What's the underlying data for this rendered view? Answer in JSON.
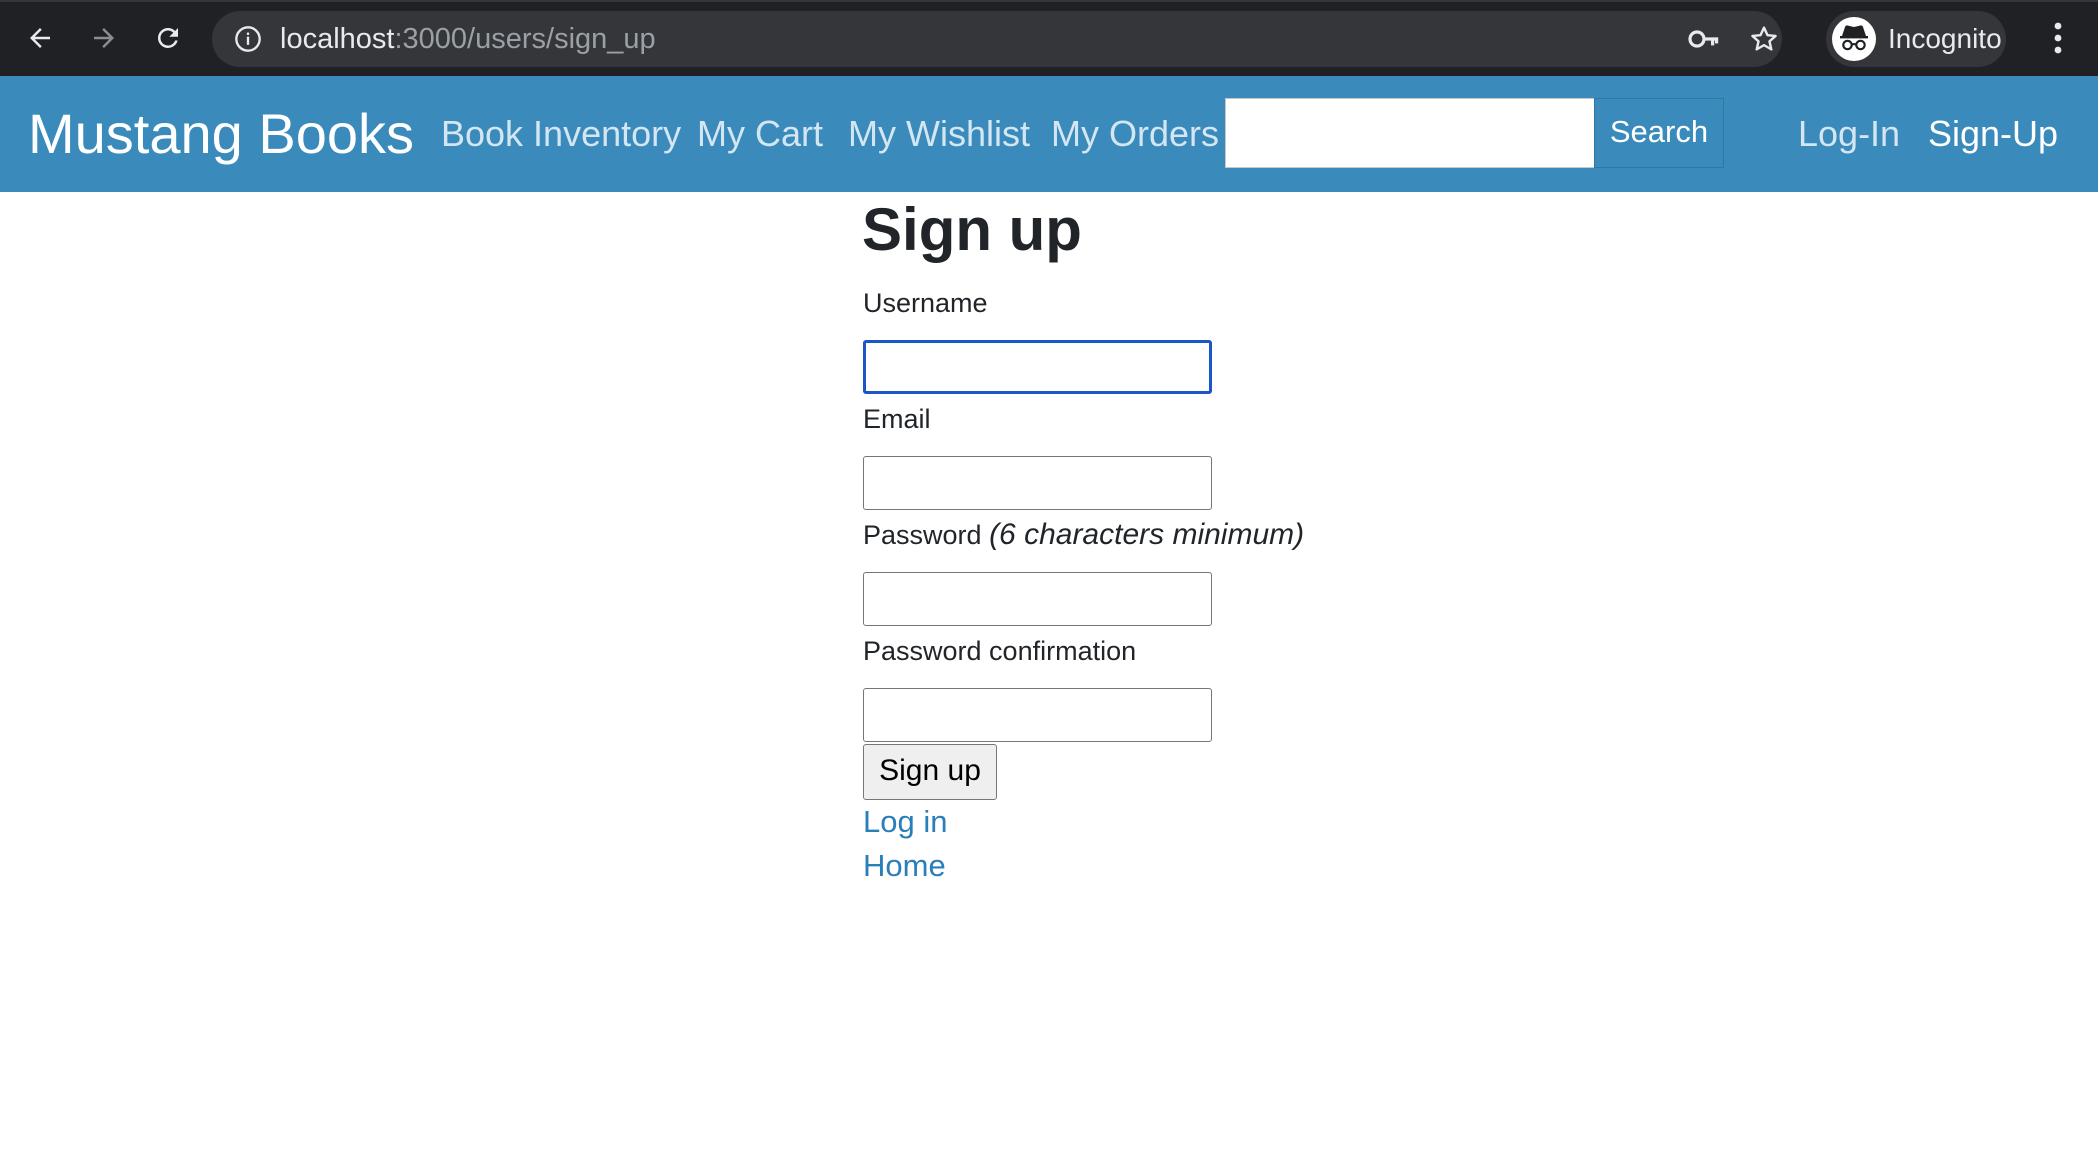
{
  "browser": {
    "url_host": "localhost",
    "url_path": ":3000/users/sign_up",
    "incognito_label": "Incognito",
    "icons": {
      "back": "back-arrow-icon",
      "forward": "forward-arrow-icon",
      "reload": "reload-icon",
      "site_info": "info-icon",
      "password": "key-icon",
      "bookmark": "star-icon",
      "profile": "incognito-icon",
      "menu": "kebab-menu-icon"
    }
  },
  "navbar": {
    "brand": "Mustang Books",
    "links": {
      "book_inventory": "Book Inventory",
      "my_cart": "My Cart",
      "my_wishlist": "My Wishlist",
      "my_orders": "My Orders",
      "log_in": "Log-In",
      "sign_up": "Sign-Up"
    },
    "search": {
      "value": "",
      "placeholder": "",
      "button_label": "Search"
    },
    "colors": {
      "background": "#3a8bbb",
      "link": "#d3e6f2"
    }
  },
  "form": {
    "title": "Sign up",
    "username_label": "Username",
    "username_value": "",
    "email_label": "Email",
    "email_value": "",
    "password_label": "Password",
    "password_hint": "(6 characters minimum)",
    "password_value": "",
    "password_confirmation_label": "Password confirmation",
    "password_confirmation_value": "",
    "submit_label": "Sign up",
    "log_in_link": "Log in",
    "home_link": "Home",
    "colors": {
      "link": "#2a7fb8",
      "focus": "#1a56c6"
    }
  }
}
